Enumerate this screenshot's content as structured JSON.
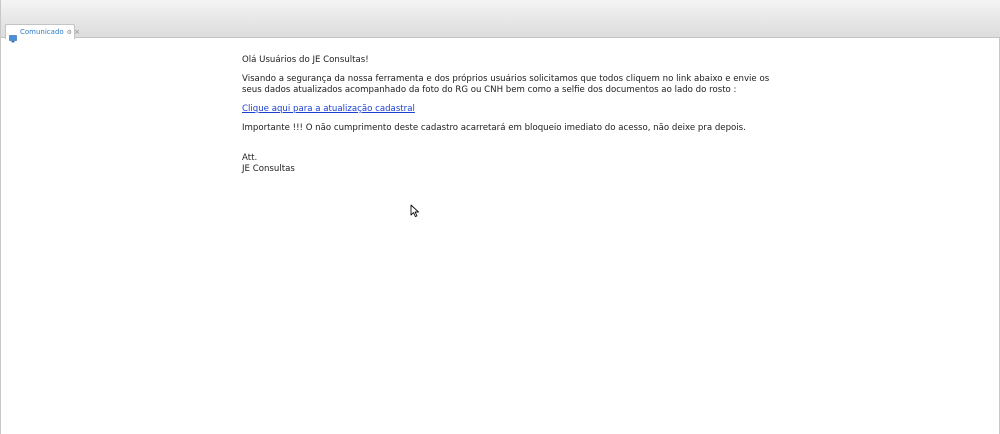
{
  "tab": {
    "label": "Comunicado",
    "gear": "⚙",
    "close": "×"
  },
  "message": {
    "greeting": "Olá Usuários do JE Consultas!",
    "body": "Visando a segurança da nossa ferramenta e dos próprios usuários solicitamos que todos cliquem no link abaixo e envie os seus dados atualizados acompanhado da foto do RG ou CNH bem como a selfie dos documentos ao lado do rosto :",
    "link_text": "Clique aqui para a atualização cadastral",
    "important": "Importante !!! O não cumprimento deste cadastro acarretará em bloqueio imediato do acesso, não deixe pra depois.",
    "signoff": "Att.",
    "signature": "JE Consultas"
  },
  "colors": {
    "tab_label": "#2e7dc8",
    "link": "#1a3fd1",
    "text": "#202020"
  },
  "icons": {
    "tab_icon": "monitor-icon",
    "cursor": "mouse-cursor-icon"
  }
}
